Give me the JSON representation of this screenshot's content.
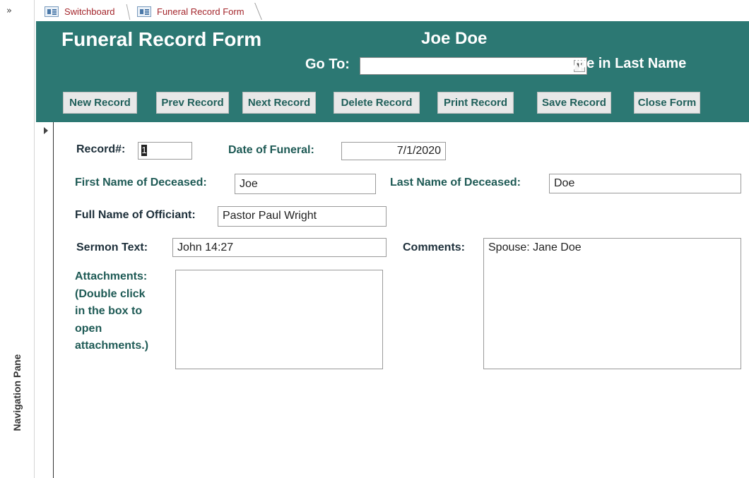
{
  "nav": {
    "chevron": "»",
    "label": "Navigation Pane"
  },
  "tabs": [
    {
      "label": "Switchboard",
      "active": false
    },
    {
      "label": "Funeral Record Form",
      "active": true
    }
  ],
  "header": {
    "title": "Funeral Record Form",
    "record_name": "Joe Doe",
    "goto_label": "Go To:",
    "goto_value": "",
    "goto_hint": "Type in Last Name",
    "background_color": "#2c7873"
  },
  "buttons": {
    "new": "New Record",
    "prev": "Prev Record",
    "next": "Next Record",
    "delete": "Delete Record",
    "print": "Print Record",
    "save": "Save Record",
    "close": "Close Form"
  },
  "form": {
    "record_label": "Record#:",
    "record_value": "1",
    "date_label": "Date of Funeral:",
    "date_value": "7/1/2020",
    "first_name_label": "First Name of Deceased:",
    "first_name_value": "Joe",
    "last_name_label": "Last Name of Deceased:",
    "last_name_value": "Doe",
    "officiant_label": "Full Name of Officiant:",
    "officiant_value": "Pastor Paul Wright",
    "sermon_label": "Sermon Text:",
    "sermon_value": "John 14:27",
    "comments_label": "Comments:",
    "comments_value": "Spouse: Jane Doe",
    "attachments_label": "Attachments: (Double click in the box to open attachments.)",
    "attachments_lines": [
      "Attachments:",
      "(Double click",
      "in the box to",
      "open",
      "attachments.)"
    ]
  }
}
